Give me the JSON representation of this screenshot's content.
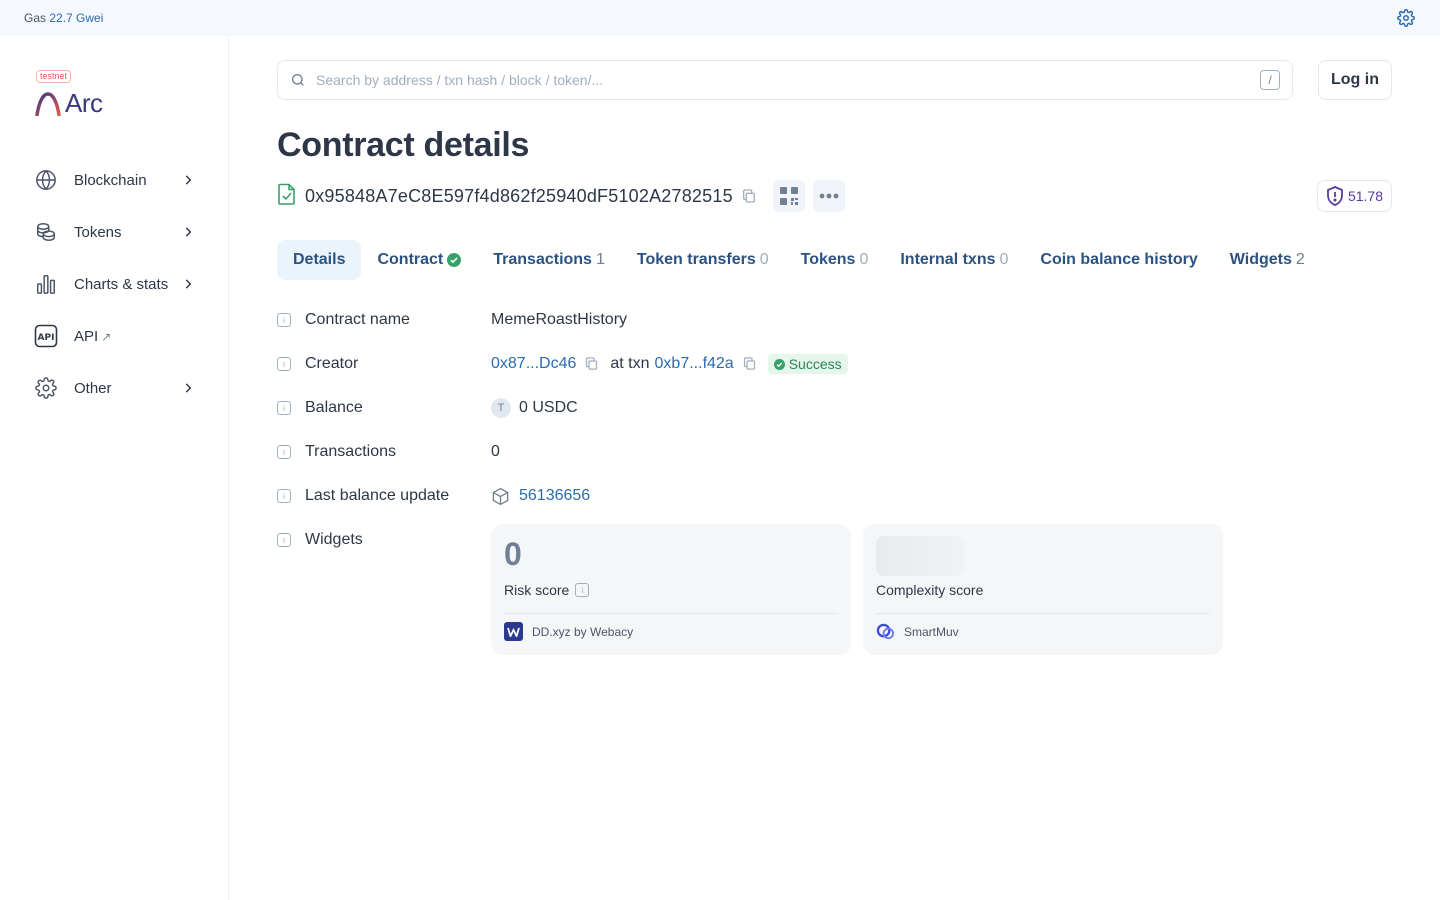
{
  "topbar": {
    "gas_label": "Gas",
    "gas_value": "22.7 Gwei"
  },
  "brand": {
    "badge": "testnet",
    "name": "Arc"
  },
  "sidebar": {
    "items": [
      {
        "label": "Blockchain",
        "icon": "globe-icon"
      },
      {
        "label": "Tokens",
        "icon": "coins-icon"
      },
      {
        "label": "Charts & stats",
        "icon": "bar-chart-icon"
      },
      {
        "label": "API",
        "icon": "api-icon",
        "external": "↗"
      },
      {
        "label": "Other",
        "icon": "gear-icon"
      }
    ]
  },
  "search": {
    "placeholder": "Search by address / txn hash / block / token/...",
    "shortcut": "/"
  },
  "header": {
    "login_label": "Log in",
    "title": "Contract details"
  },
  "contract": {
    "address": "0x95848A7eC8E597f4d862f25940dF5102A2782515",
    "score": "51.78"
  },
  "tabs": [
    {
      "label": "Details",
      "count": ""
    },
    {
      "label": "Contract",
      "count": ""
    },
    {
      "label": "Transactions",
      "count": "1"
    },
    {
      "label": "Token transfers",
      "count": "0"
    },
    {
      "label": "Tokens",
      "count": "0"
    },
    {
      "label": "Internal txns",
      "count": "0"
    },
    {
      "label": "Coin balance history",
      "count": ""
    },
    {
      "label": "Widgets",
      "count": "2"
    }
  ],
  "details": {
    "contract_name": {
      "label": "Contract name",
      "value": "MemeRoastHistory"
    },
    "creator": {
      "label": "Creator",
      "address": "0x87...Dc46",
      "at_txn": "at txn",
      "txn": "0xb7...f42a",
      "status": "Success"
    },
    "balance": {
      "label": "Balance",
      "token_letter": "T",
      "value": "0 USDC"
    },
    "transactions": {
      "label": "Transactions",
      "value": "0"
    },
    "last_balance_update": {
      "label": "Last balance update",
      "value": "56136656"
    },
    "widgets": {
      "label": "Widgets"
    }
  },
  "widget_cards": [
    {
      "value": "0",
      "label": "Risk score",
      "source": "DD.xyz by Webacy"
    },
    {
      "value": "",
      "label": "Complexity score",
      "source": "SmartMuv"
    }
  ],
  "colors": {
    "accent": "#2b6cb0",
    "success": "#25855a",
    "brand": "#3b3780"
  }
}
